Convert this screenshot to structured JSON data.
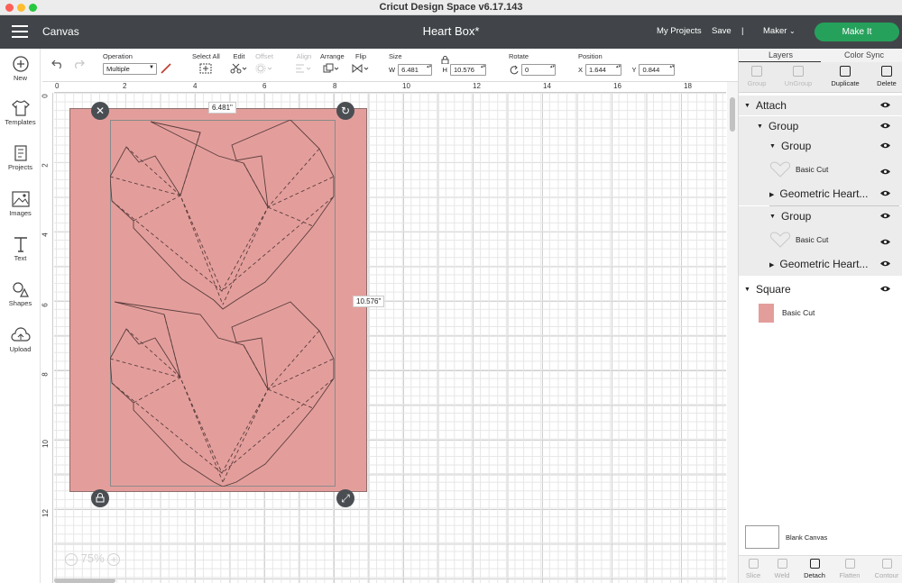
{
  "window": {
    "title": "Cricut Design Space  v6.17.143"
  },
  "header": {
    "section": "Canvas",
    "project_title": "Heart Box*",
    "my_projects": "My Projects",
    "save": "Save",
    "divider": "|",
    "machine": "Maker",
    "make_it": "Make It"
  },
  "toolbar": {
    "operation": {
      "label": "Operation",
      "value": "Multiple"
    },
    "select_all": "Select All",
    "edit": "Edit",
    "offset": "Offset",
    "align": "Align",
    "arrange": "Arrange",
    "flip": "Flip",
    "size": {
      "label": "Size",
      "w_label": "W",
      "w": "6.481",
      "h_label": "H",
      "h": "10.576"
    },
    "rotate": {
      "label": "Rotate",
      "value": "0"
    },
    "position": {
      "label": "Position",
      "x_label": "X",
      "x": "1.644",
      "y_label": "Y",
      "y": "0.844"
    }
  },
  "sidebar": {
    "items": [
      {
        "label": "New",
        "icon": "plus-circle-icon"
      },
      {
        "label": "Templates",
        "icon": "shirt-icon"
      },
      {
        "label": "Projects",
        "icon": "projects-icon"
      },
      {
        "label": "Images",
        "icon": "image-icon"
      },
      {
        "label": "Text",
        "icon": "text-icon"
      },
      {
        "label": "Shapes",
        "icon": "shapes-icon"
      },
      {
        "label": "Upload",
        "icon": "upload-icon"
      }
    ]
  },
  "ruler": {
    "top": [
      "0",
      "2",
      "4",
      "6",
      "8",
      "10",
      "12",
      "14",
      "16",
      "18"
    ],
    "left": [
      "0",
      "2",
      "4",
      "6",
      "8",
      "10",
      "12"
    ]
  },
  "canvas": {
    "width_label": "6.481\"",
    "height_label": "10.576\"",
    "zoom": "75%",
    "square_color": "#e39e9b"
  },
  "layers_panel": {
    "tabs": [
      "Layers",
      "Color Sync"
    ],
    "actions": [
      "Group",
      "UnGroup",
      "Duplicate",
      "Delete"
    ],
    "rows": [
      {
        "name": "Attach"
      },
      {
        "name": "Group"
      },
      {
        "name": "Group"
      },
      {
        "name": "Basic Cut"
      },
      {
        "name": "Geometric Heart..."
      },
      {
        "name": "Group"
      },
      {
        "name": "Basic Cut"
      },
      {
        "name": "Geometric Heart..."
      },
      {
        "name": "Square"
      },
      {
        "name": "Basic Cut"
      }
    ],
    "blank_canvas": "Blank Canvas",
    "bottom_actions": [
      "Slice",
      "Weld",
      "Detach",
      "Flatten",
      "Contour"
    ]
  },
  "colors": {
    "accent_green": "#26a15c",
    "header_bg": "#414549",
    "shape_pink": "#e39e9b"
  }
}
